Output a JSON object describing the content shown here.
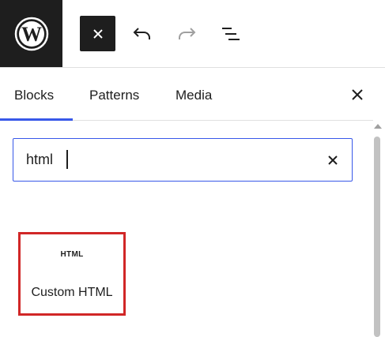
{
  "toolbar": {
    "logo_icon": "wordpress-icon",
    "close_icon": "close-icon",
    "undo_icon": "undo-icon",
    "redo_icon": "redo-icon",
    "list_view_icon": "list-view-icon"
  },
  "tabs": [
    {
      "label": "Blocks",
      "active": true
    },
    {
      "label": "Patterns",
      "active": false
    },
    {
      "label": "Media",
      "active": false
    }
  ],
  "search": {
    "value": "html",
    "clear_icon": "close-icon"
  },
  "results": [
    {
      "icon_text": "HTML",
      "label": "Custom HTML",
      "highlighted": true
    }
  ],
  "colors": {
    "accent": "#3858e9",
    "dark": "#1e1e1e",
    "highlight_border": "#d12727"
  }
}
